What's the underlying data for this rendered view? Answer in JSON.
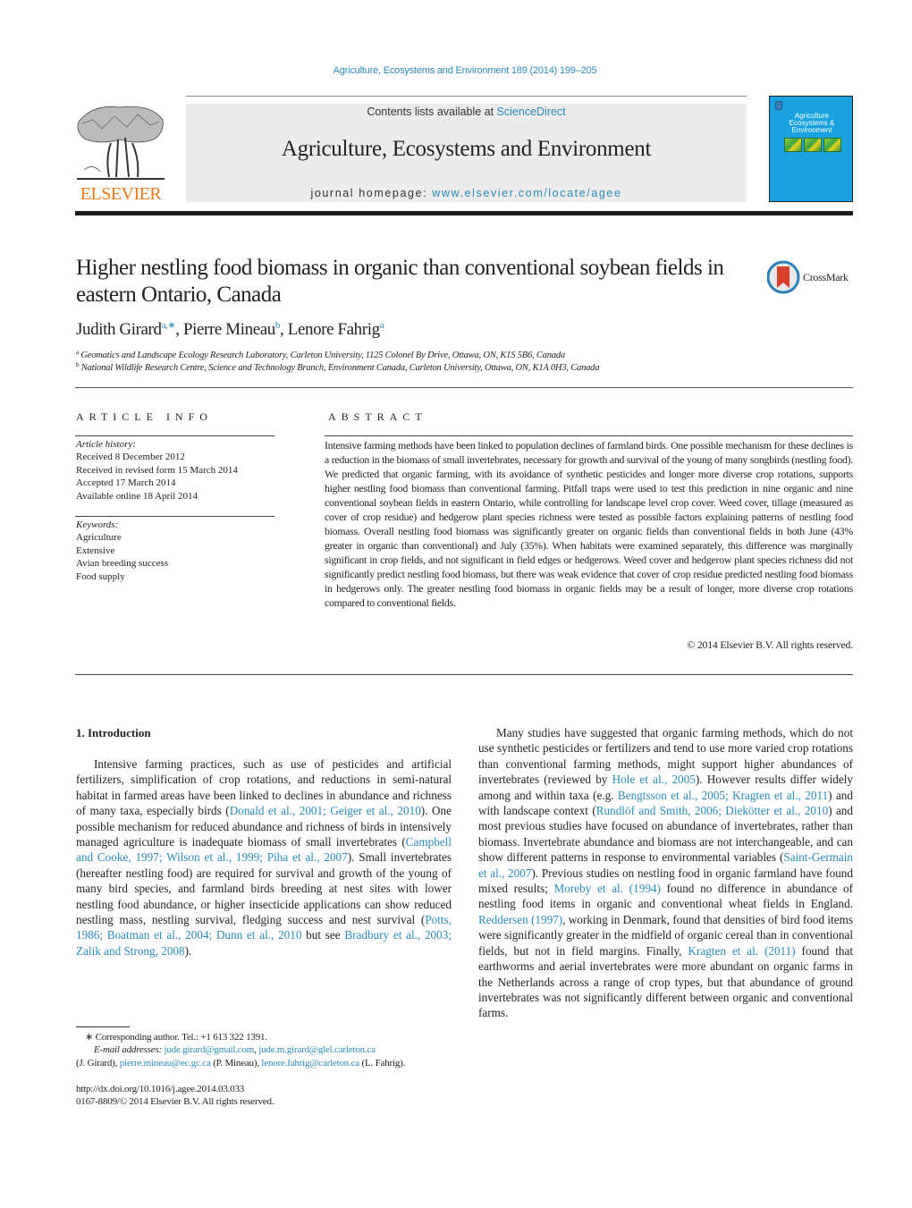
{
  "header": {
    "journal_ref": "Agriculture, Ecosystems and Environment 189 (2014) 199–205",
    "contents_prefix": "Contents lists available at ",
    "contents_link": "ScienceDirect",
    "journal_title": "Agriculture, Ecosystems and Environment",
    "homepage_prefix": "journal homepage: ",
    "homepage_link": "www.elsevier.com/locate/agee",
    "publisher_logo_text": "ELSEVIER",
    "cover": {
      "title_lines": [
        "Agriculture",
        "Ecosystems &",
        "Environment"
      ],
      "color": "#1aa2e0"
    }
  },
  "article": {
    "title": "Higher nestling food biomass in organic than conventional soybean fields in eastern Ontario, Canada",
    "crossmark_label": "CrossMark",
    "authors": [
      {
        "name": "Judith Girard",
        "sup": "a,∗"
      },
      {
        "name": "Pierre Mineau",
        "sup": "b"
      },
      {
        "name": "Lenore Fahrig",
        "sup": "a"
      }
    ],
    "affiliations": [
      {
        "key": "a",
        "text": "Geomatics and Landscape Ecology Research Laboratory, Carleton University, 1125 Colonel By Drive, Ottawa, ON, K1S 5B6, Canada"
      },
      {
        "key": "b",
        "text": "National Wildlife Research Centre, Science and Technology Branch, Environment Canada, Carleton University, Ottawa, ON, K1A 0H3, Canada"
      }
    ]
  },
  "article_info": {
    "heading": "ARTICLE INFO",
    "history_label": "Article history:",
    "history": [
      "Received 8 December 2012",
      "Received in revised form 15 March 2014",
      "Accepted 17 March 2014",
      "Available online 18 April 2014"
    ],
    "keywords_label": "Keywords:",
    "keywords": [
      "Agriculture",
      "Extensive",
      "Avian breeding success",
      "Food supply"
    ]
  },
  "abstract": {
    "heading": "ABSTRACT",
    "text": "Intensive farming methods have been linked to population declines of farmland birds. One possible mechanism for these declines is a reduction in the biomass of small invertebrates, necessary for growth and survival of the young of many songbirds (nestling food). We predicted that organic farming, with its avoidance of synthetic pesticides and longer more diverse crop rotations, supports higher nestling food biomass than conventional farming. Pitfall traps were used to test this prediction in nine organic and nine conventional soybean fields in eastern Ontario, while controlling for landscape level crop cover. Weed cover, tillage (measured as cover of crop residue) and hedgerow plant species richness were tested as possible factors explaining patterns of nestling food biomass. Overall nestling food biomass was significantly greater on organic fields than conventional fields in both June (43% greater in organic than conventional) and July (35%). When habitats were examined separately, this difference was marginally significant in crop fields, and not significant in field edges or hedgerows. Weed cover and hedgerow plant species richness did not significantly predict nestling food biomass, but there was weak evidence that cover of crop residue predicted nestling food biomass in hedgerows only. The greater nestling food biomass in organic fields may be a result of longer, more diverse crop rotations compared to conventional fields.",
    "copyright": "© 2014 Elsevier B.V. All rights reserved."
  },
  "body": {
    "section_heading": "1.  Introduction",
    "left_para": [
      {
        "t": "Intensive farming practices, such as use of pesticides and artificial fertilizers, simplification of crop rotations, and reductions in semi-natural habitat in farmed areas have been linked to declines in abundance and richness of many taxa, especially birds ("
      },
      {
        "t": "Donald et al., 2001; Geiger et al., 2010",
        "link": true
      },
      {
        "t": "). One possible mechanism for reduced abundance and richness of birds in intensively managed agriculture is inadequate biomass of small invertebrates ("
      },
      {
        "t": "Campbell and Cooke, 1997; Wilson et al., 1999; Piha et al., 2007",
        "link": true
      },
      {
        "t": "). Small invertebrates (hereafter nestling food) are required for survival and growth of the young of many bird species, and farmland birds breeding at nest sites with lower nestling food abundance, or higher insecticide applications can show reduced nestling mass, nestling survival, fledging success and nest survival ("
      },
      {
        "t": "Potts, 1986; Boatman et al., 2004; Dunn et al., 2010",
        "link": true
      },
      {
        "t": " but see "
      },
      {
        "t": "Bradbury et al., 2003; Zalik and Strong, 2008",
        "link": true
      },
      {
        "t": ")."
      }
    ],
    "right_para": [
      {
        "t": "Many studies have suggested that organic farming methods, which do not use synthetic pesticides or fertilizers and tend to use more varied crop rotations than conventional farming methods, might support higher abundances of invertebrates (reviewed by "
      },
      {
        "t": "Hole et al., 2005",
        "link": true
      },
      {
        "t": "). However results differ widely among and within taxa (e.g. "
      },
      {
        "t": "Bengtsson et al., 2005; Kragten et al., 2011",
        "link": true
      },
      {
        "t": ") and with landscape context ("
      },
      {
        "t": "Rundlöf and Smith, 2006; Diekötter et al., 2010",
        "link": true
      },
      {
        "t": ") and most previous studies have focused on abundance of invertebrates, rather than biomass. Invertebrate abundance and biomass are not interchangeable, and can show different patterns in response to environmental variables ("
      },
      {
        "t": "Saint-Germain et al., 2007",
        "link": true
      },
      {
        "t": "). Previous studies on nestling food in organic farmland have found mixed results; "
      },
      {
        "t": "Moreby et al. (1994)",
        "link": true
      },
      {
        "t": " found no difference in abundance of nestling food items in organic and conventional wheat fields in England. "
      },
      {
        "t": "Reddersen (1997)",
        "link": true
      },
      {
        "t": ", working in Denmark, found that densities of bird food items were significantly greater in the midfield of organic cereal than in conventional fields, but not in field margins. Finally, "
      },
      {
        "t": "Kragten et al. (2011)",
        "link": true
      },
      {
        "t": " found that earthworms and aerial invertebrates were more abundant on organic farms in the Netherlands across a range of crop types, but that abundance of ground invertebrates was not significantly different between organic and conventional farms."
      }
    ]
  },
  "footnotes": {
    "corresponding": "∗  Corresponding author. Tel.: +1 613 322 1391.",
    "email_label": "E-mail addresses:",
    "email_1": "jude.girard@gmail.com",
    "email_2": "jude.m.girard@glel.carleton.ca",
    "owner_1": "(J. Girard), ",
    "email_3": "pierre.mineau@ec.gc.ca",
    "owner_3": " (P. Mineau), ",
    "email_4": "lenore.fahrig@carleton.ca",
    "owner_4": " (L. Fahrig).",
    "doi": "http://dx.doi.org/10.1016/j.agee.2014.03.033",
    "issn": "0167-8809/© 2014 Elsevier B.V. All rights reserved."
  },
  "colors": {
    "link": "#2a8bb8",
    "elsevier_orange": "#f07a1a",
    "banner_bg": "#ececec"
  }
}
